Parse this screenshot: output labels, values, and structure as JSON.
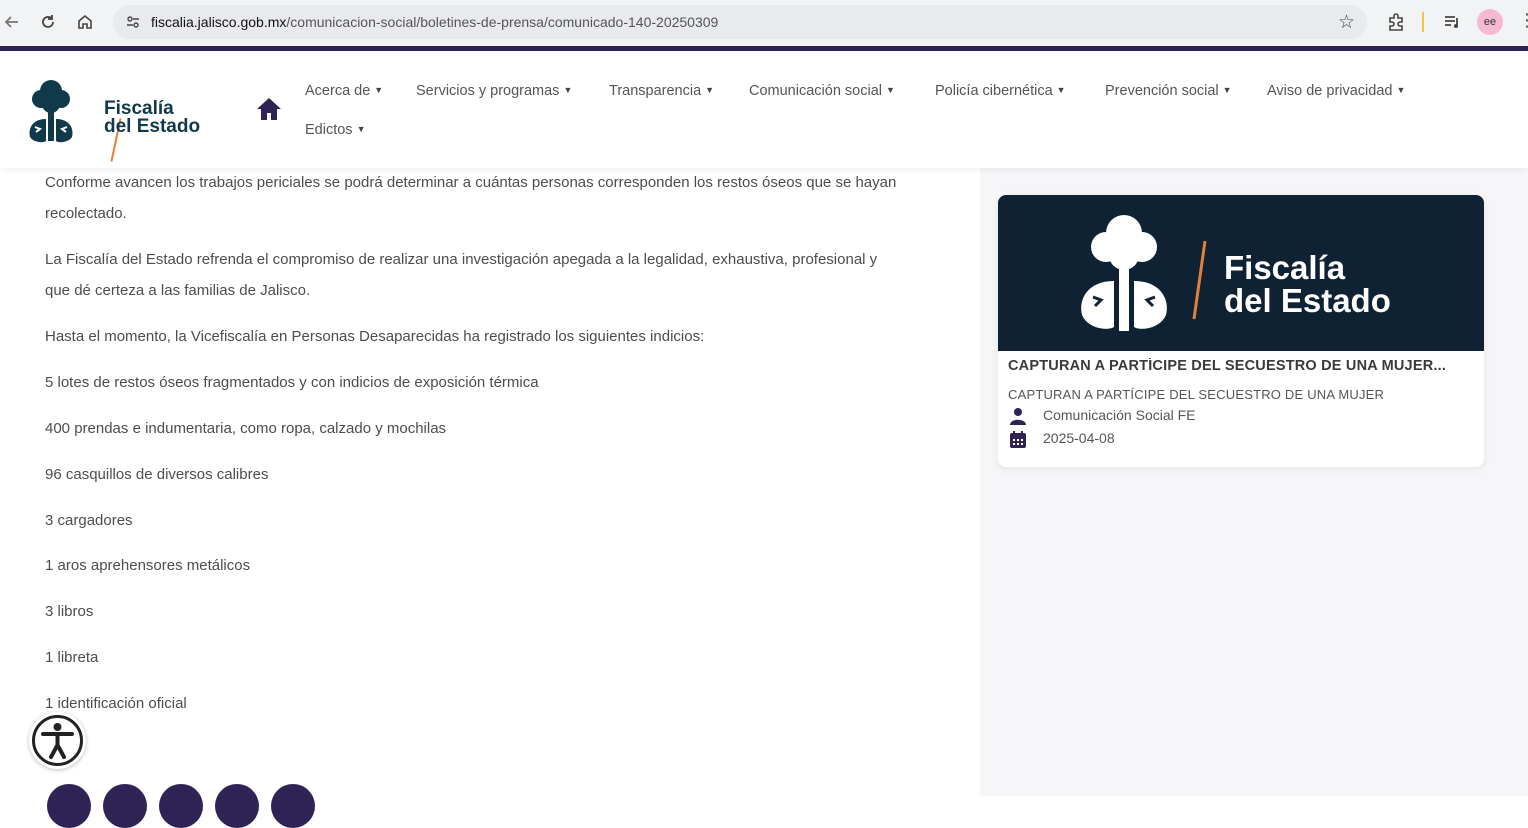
{
  "browser": {
    "url_host": "fiscalia.jalisco.gob.mx",
    "url_path": "/comunicacion-social/boletines-de-prensa/comunicado-140-20250309",
    "profile_initials": "ee",
    "icons": [
      "back-icon",
      "reload-icon",
      "home-icon",
      "site-settings-icon",
      "star-icon",
      "extensions-icon",
      "media-controls-icon",
      "menu-icon"
    ]
  },
  "site": {
    "logo_line1": "Fiscalía",
    "logo_line2": "del Estado",
    "nav": [
      {
        "label": "Acerca de"
      },
      {
        "label": "Servicios y programas"
      },
      {
        "label": "Transparencia"
      },
      {
        "label": "Comunicación social"
      },
      {
        "label": "Policía cibernética"
      },
      {
        "label": "Prevención social"
      },
      {
        "label": "Aviso de privacidad"
      },
      {
        "label": "Edictos"
      }
    ]
  },
  "article": {
    "paragraphs": [
      "Conforme avancen los trabajos periciales se podrá determinar a cuántas personas corresponden los restos óseos que se hayan recolectado.",
      "La Fiscalía del Estado refrenda el compromiso de realizar una investigación apegada a la legalidad, exhaustiva, profesional y que dé certeza a las familias de Jalisco.",
      "Hasta el momento, la Vicefiscalía en Personas Desaparecidas ha registrado los siguientes indicios:",
      "5 lotes de restos óseos fragmentados y con indicios de exposición térmica",
      "400 prendas e indumentaria, como ropa, calzado y mochilas",
      "96 casquillos de diversos calibres",
      "3 cargadores",
      "1 aros aprehensores metálicos",
      "3 libros",
      "1 libreta",
      "1 identificación oficial"
    ]
  },
  "sidebar": {
    "card": {
      "image_line1": "Fiscalía",
      "image_line2": "del Estado",
      "title": "CAPTURAN A PARTÍCIPE DEL SECUESTRO DE UNA MUJER...",
      "subtitle": "CAPTURAN A PARTÍCIPE DEL SECUESTRO DE UNA MUJER",
      "author": "Comunicación Social FE",
      "date": "2025-04-08"
    }
  },
  "colors": {
    "brand_purple": "#2f2355",
    "logo_teal": "#103a4a",
    "logo_orange": "#e0803a",
    "card_image_bg": "#0e2233"
  }
}
